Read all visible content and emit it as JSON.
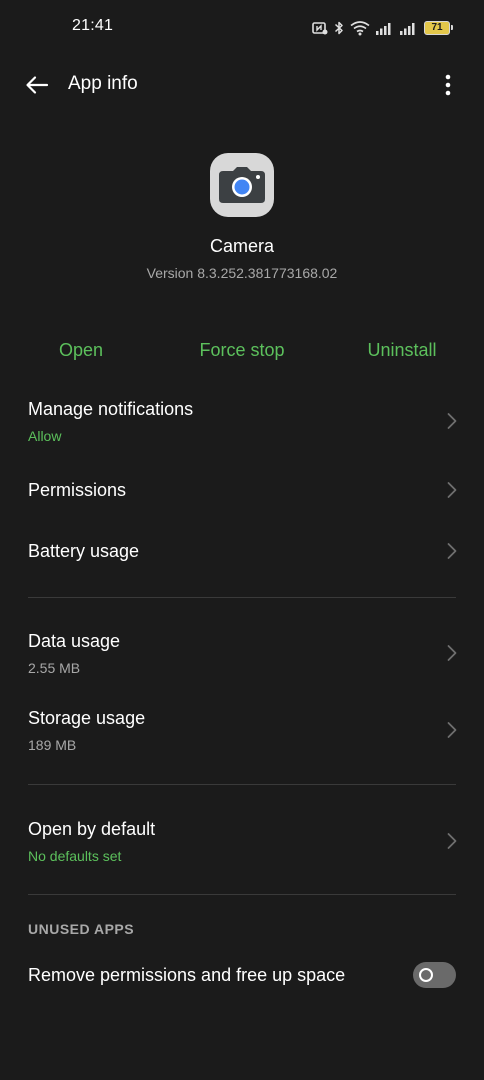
{
  "status_bar": {
    "time": "21:41",
    "battery_level": "71",
    "icons": [
      "nfc-icon",
      "bluetooth-icon",
      "wifi-icon",
      "signal-icon",
      "signal-icon",
      "battery-icon"
    ]
  },
  "toolbar": {
    "title": "App info",
    "back_icon": "arrow-left-icon",
    "more_icon": "more-vert-icon"
  },
  "app": {
    "name": "Camera",
    "version": "Version 8.3.252.381773168.02",
    "icon": "camera-icon"
  },
  "actions": {
    "open": "Open",
    "force_stop": "Force stop",
    "uninstall": "Uninstall"
  },
  "settings": {
    "notifications": {
      "title": "Manage notifications",
      "subtitle": "Allow"
    },
    "permissions": {
      "title": "Permissions"
    },
    "battery": {
      "title": "Battery usage"
    },
    "data": {
      "title": "Data usage",
      "subtitle": "2.55 MB"
    },
    "storage": {
      "title": "Storage usage",
      "subtitle": "189 MB"
    },
    "open_by_default": {
      "title": "Open by default",
      "subtitle": "No defaults set"
    }
  },
  "unused_apps": {
    "header": "UNUSED APPS",
    "remove_permissions": {
      "title": "Remove permissions and free up space",
      "enabled": false
    }
  },
  "colors": {
    "background": "#1b1b1b",
    "accent_green": "#5cc05c",
    "secondary_text": "#a8a8a8"
  }
}
